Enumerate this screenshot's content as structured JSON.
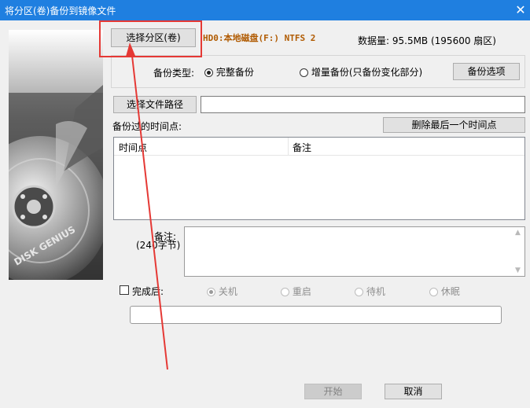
{
  "window": {
    "title": "将分区(卷)备份到镜像文件",
    "close_glyph": "✕"
  },
  "partition": {
    "select_button": "选择分区(卷)",
    "selected_text": "HD0:本地磁盘(F:) NTFS 2",
    "data_size_text": "数据量: 95.5MB (195600 扇区)"
  },
  "backup_type": {
    "label": "备份类型:",
    "options": [
      {
        "label": "完整备份",
        "selected": true
      },
      {
        "label": "增量备份(只备份变化部分)",
        "selected": false
      }
    ],
    "options_button": "备份选项"
  },
  "file_path": {
    "select_button": "选择文件路径",
    "value": ""
  },
  "timepoints": {
    "label": "备份过的时间点:",
    "delete_last_button": "删除最后一个时间点",
    "columns": [
      "时间点",
      "备注"
    ],
    "rows": []
  },
  "note": {
    "label": "备注:",
    "sublabel": "(240字节)",
    "value": ""
  },
  "after_completion": {
    "checkbox_label": "完成后:",
    "checked": false,
    "options": [
      {
        "label": "关机",
        "selected": true
      },
      {
        "label": "重启",
        "selected": false
      },
      {
        "label": "待机",
        "selected": false
      },
      {
        "label": "休眠",
        "selected": false
      }
    ]
  },
  "progress": {
    "value": 0
  },
  "footer": {
    "start_button": "开始",
    "cancel_button": "取消"
  },
  "logo": {
    "brand_text": "DISK GENIUS"
  },
  "colors": {
    "titlebar": "#1f7fe0",
    "partition_text": "#b05a00",
    "annotation": "#e53935"
  }
}
